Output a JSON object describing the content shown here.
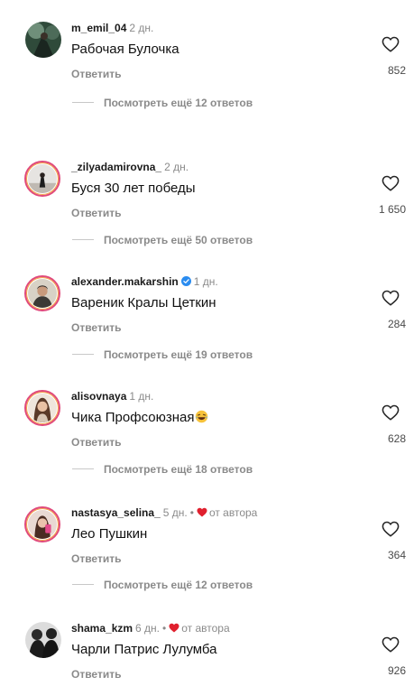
{
  "comments": [
    {
      "username": "m_emil_04",
      "time": "2 дн.",
      "text": "Рабочая Булочка",
      "reply_label": "Ответить",
      "likes": "852",
      "view_replies": "Посмотреть ещё 12 ответов"
    },
    {
      "username": "_zilyadamirovna_",
      "time": "2 дн.",
      "text": "Буся 30 лет победы",
      "reply_label": "Ответить",
      "likes": "1 650",
      "view_replies": "Посмотреть ещё 50 ответов"
    },
    {
      "username": "alexander.makarshin",
      "time": "1 дн.",
      "verified": true,
      "text": "Вареник Кралы Цеткин",
      "reply_label": "Ответить",
      "likes": "284",
      "view_replies": "Посмотреть ещё 19 ответов"
    },
    {
      "username": "alisovnaya",
      "time": "1 дн.",
      "text": "Чика Профсоюзная",
      "emoji": "laughing-emoji",
      "reply_label": "Ответить",
      "likes": "628",
      "view_replies": "Посмотреть ещё 18 ответов"
    },
    {
      "username": "nastasya_selina_",
      "time": "5 дн.",
      "dot": "•",
      "author_label": "от автора",
      "text": "Лео Пушкин",
      "reply_label": "Ответить",
      "likes": "364",
      "view_replies": "Посмотреть ещё 12 ответов"
    },
    {
      "username": "shama_kzm",
      "time": "6 дн.",
      "dot": "•",
      "author_label": "от автора",
      "text": "Чарли Патрис Лулумба",
      "reply_label": "Ответить",
      "likes": "926"
    }
  ],
  "colors": {
    "author_heart": "#e0202e",
    "verified_badge": "#2a8cf0",
    "story_ring": "#e04a7c",
    "muted_text": "#8a8a8a"
  },
  "icons": {
    "like": "heart-outline-icon",
    "author_like": "heart-filled-icon",
    "verified": "verified-badge-icon"
  }
}
